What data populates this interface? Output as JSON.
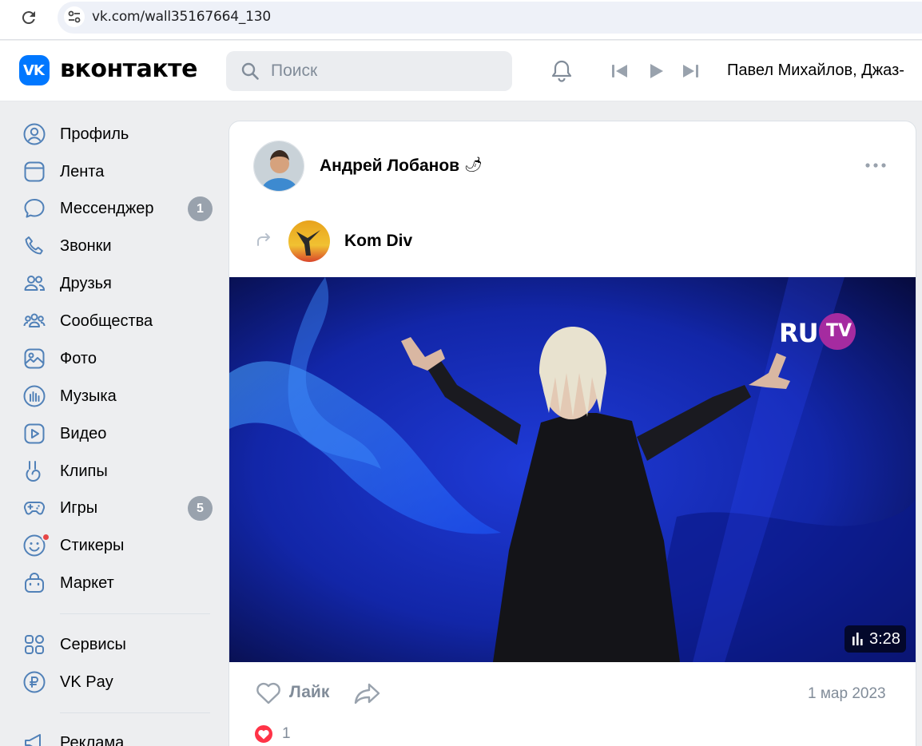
{
  "browser": {
    "url": "vk.com/wall35167664_130"
  },
  "header": {
    "logo_text": "VK",
    "brand": "вконтакте",
    "search_placeholder": "Поиск",
    "now_playing": "Павел Михайлов, Джаз-"
  },
  "sidebar": {
    "items": [
      {
        "label": "Профиль",
        "icon": "user-circle-icon"
      },
      {
        "label": "Лента",
        "icon": "news-feed-icon"
      },
      {
        "label": "Мессенджер",
        "icon": "message-icon",
        "badge": "1"
      },
      {
        "label": "Звонки",
        "icon": "phone-icon"
      },
      {
        "label": "Друзья",
        "icon": "friends-icon"
      },
      {
        "label": "Сообщества",
        "icon": "communities-icon"
      },
      {
        "label": "Фото",
        "icon": "photo-icon"
      },
      {
        "label": "Музыка",
        "icon": "music-icon"
      },
      {
        "label": "Видео",
        "icon": "video-icon"
      },
      {
        "label": "Клипы",
        "icon": "clips-icon"
      },
      {
        "label": "Игры",
        "icon": "gamepad-icon",
        "badge": "5"
      },
      {
        "label": "Стикеры",
        "icon": "sticker-icon"
      },
      {
        "label": "Маркет",
        "icon": "market-bag-icon"
      },
      {
        "label": "Сервисы",
        "icon": "services-grid-icon"
      },
      {
        "label": "VK Pay",
        "icon": "ruble-coin-icon"
      },
      {
        "label": "Реклама",
        "icon": "megaphone-icon"
      }
    ]
  },
  "post": {
    "author": "Андрей Лобанов",
    "author_emoji": "🌶",
    "repost_source": "Kom Div",
    "video": {
      "duration": "3:28",
      "channel_logo_left": "RU",
      "channel_logo_right": "TV"
    },
    "like_label": "Лайк",
    "date": "1 мар 2023",
    "reactions_count": "1"
  },
  "colors": {
    "vk_blue": "#0077ff",
    "muted_text": "#818c99",
    "badge_gray": "#99a2ad",
    "reaction_red": "#ff3347"
  }
}
